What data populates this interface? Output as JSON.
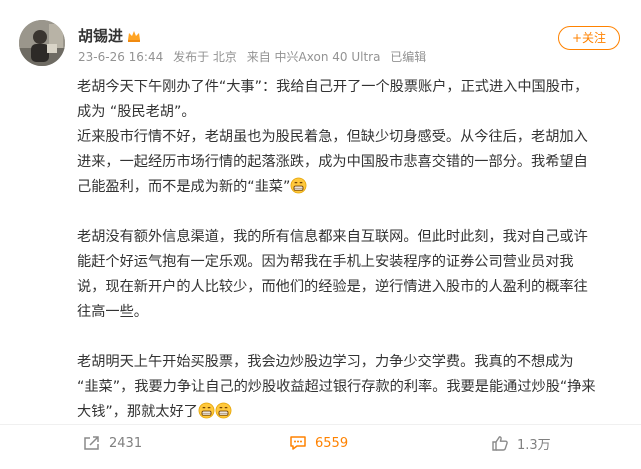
{
  "user": {
    "name": "胡锡进"
  },
  "meta": {
    "time": "23-6-26 16:44",
    "location": "发布于 北京",
    "device": "来自 中兴Axon 40 Ultra",
    "edited": "已编辑"
  },
  "follow": {
    "label": "+关注"
  },
  "post": {
    "p1_l1": "老胡今天下午刚办了件“大事”：我给自己开了一个股票账户，正式进入中国股市，",
    "p1_l2": "成为 “股民老胡”。",
    "p2_l1": "近来股市行情不好，老胡虽也为股民着急，但缺少切身感受。从今往后，老胡加入",
    "p2_l2": "进来，一起经历市场行情的起落涨跌，成为中国股市悲喜交错的一部分。我希望自",
    "p2_l3": "己能盈利，而不是成为新的“韭菜”",
    "p3_l1": "老胡没有额外信息渠道，我的所有信息都来自互联网。但此时此刻，我对自己或许",
    "p3_l2": "能赶个好运气抱有一定乐观。因为帮我在手机上安装程序的证券公司营业员对我",
    "p3_l3": "说，现在新开户的人比较少，而他们的经验是，逆行情进入股市的人盈利的概率往",
    "p3_l4": "往高一些。",
    "p4_l1": "老胡明天上午开始买股票，我会边炒股边学习，力争少交学费。我真的不想成为",
    "p4_l2": "“韭菜”，我要力争让自己的炒股收益超过银行存款的利率。我要是能通过炒股“挣来",
    "p4_l3": "大钱”，那就太好了"
  },
  "actions": {
    "reposts": "2431",
    "comments": "6559",
    "likes": "1.3万"
  },
  "icons": {
    "vip": "crown-icon",
    "emoji": "grin-emoji-icon",
    "repost": "repost-icon",
    "comment": "comment-icon",
    "like": "thumbs-up-icon"
  },
  "colors": {
    "accent": "#ff8200",
    "meta": "#939393"
  }
}
